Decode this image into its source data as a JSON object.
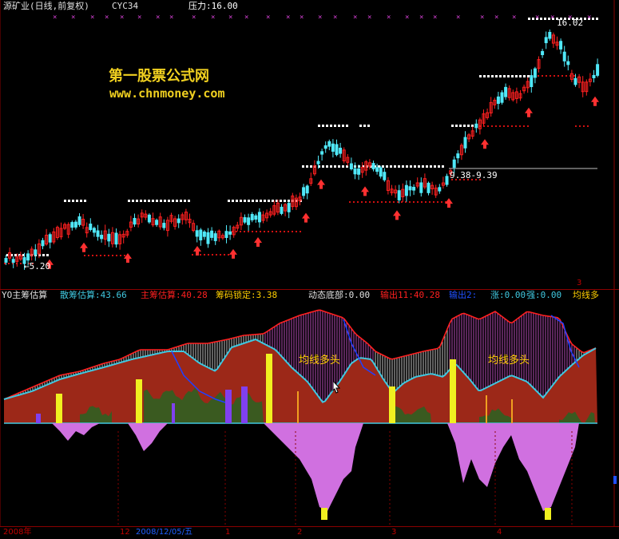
{
  "header": {
    "stock_title": "源矿业(日线,前复权)",
    "indicator": "CYC34",
    "pressure_label": "压力:16.00"
  },
  "watermark": {
    "name": "第一股票公式网",
    "url": "www.chnmoney.com"
  },
  "price_annotations": {
    "high": "16.02",
    "low": "←5.20",
    "range": "9.38-9.39"
  },
  "indicator_header": [
    {
      "id": "title",
      "text": "YO主筹估算",
      "color": "#e0e0e0"
    },
    {
      "id": "retail",
      "text": "散筹估算:43.66",
      "color": "#40c8e0"
    },
    {
      "id": "main",
      "text": "主筹估算:40.28",
      "color": "#ff2020"
    },
    {
      "id": "lock",
      "text": "筹码锁定:3.38",
      "color": "#ffd000"
    },
    {
      "id": "bottom",
      "text": "动态底部:0.00",
      "color": "#e0e0e0"
    },
    {
      "id": "out",
      "text": "输出11:40.28",
      "color": "#ff2020"
    },
    {
      "id": "out2",
      "text": "输出2:",
      "color": "#2050ff"
    },
    {
      "id": "rise",
      "text": "涨:0.00",
      "color": "#40c8e0"
    },
    {
      "id": "strong",
      "text": "强:0.00",
      "color": "#40c8e0"
    },
    {
      "id": "avg",
      "text": "均线多",
      "color": "#ffd000"
    }
  ],
  "panel_labels": {
    "bull1": "均线多头",
    "bull2": "均线多头"
  },
  "date_axis": {
    "year": "2008年",
    "m12": "12",
    "cursor_date": "2008/12/05/五",
    "m1": "1",
    "m2": "2",
    "m3": "3",
    "m4": "4",
    "right_mark": "3"
  },
  "colors": {
    "up_candle": "#ff2020",
    "down_candle": "#50e8f8",
    "resistance_dots": "#ffffff",
    "support_dots": "#d01010",
    "main_chips": "#9c2818",
    "retail_line": "#40c8e0",
    "bottom_area": "#d070e0",
    "lock_bar": "#f0f020",
    "purple_bar": "#8040f0"
  }
}
